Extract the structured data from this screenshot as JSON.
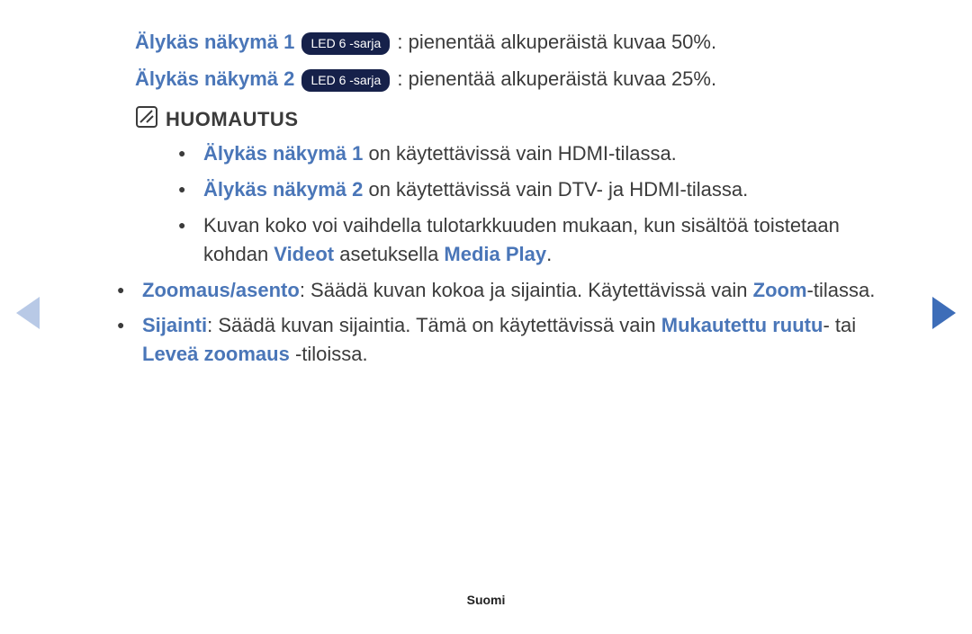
{
  "smartview1": {
    "label": "Älykäs näkymä 1",
    "badge": "LED 6 -sarja",
    "desc": ": pienentää alkuperäistä kuvaa 50%."
  },
  "smartview2": {
    "label": "Älykäs näkymä 2",
    "badge": "LED 6 -sarja",
    "desc": ": pienentää alkuperäistä kuvaa 25%."
  },
  "note_title": "HUOMAUTUS",
  "note_items": {
    "n1": {
      "label": "Älykäs näkymä 1",
      "rest": " on käytettävissä vain HDMI-tilassa."
    },
    "n2": {
      "label": "Älykäs näkymä 2",
      "rest": " on käytettävissä vain DTV- ja HDMI-tilassa."
    },
    "n3": {
      "pre": "Kuvan koko voi vaihdella tulotarkkuuden mukaan, kun sisältöä toistetaan kohdan ",
      "h1": "Videot",
      "mid": " asetuksella ",
      "h2": "Media Play",
      "post": "."
    }
  },
  "zoom": {
    "label": "Zoomaus/asento",
    "mid": ": Säädä kuvan kokoa ja sijaintia. Käytettävissä vain ",
    "h": "Zoom",
    "post": "-tilassa."
  },
  "position": {
    "label": "Sijainti",
    "mid": ": Säädä kuvan sijaintia. Tämä on käytettävissä vain ",
    "h1": "Mukautettu ruutu",
    "mid2": "- tai ",
    "h2": "Leveä zoomaus",
    "post": " -tiloissa."
  },
  "footer": "Suomi"
}
